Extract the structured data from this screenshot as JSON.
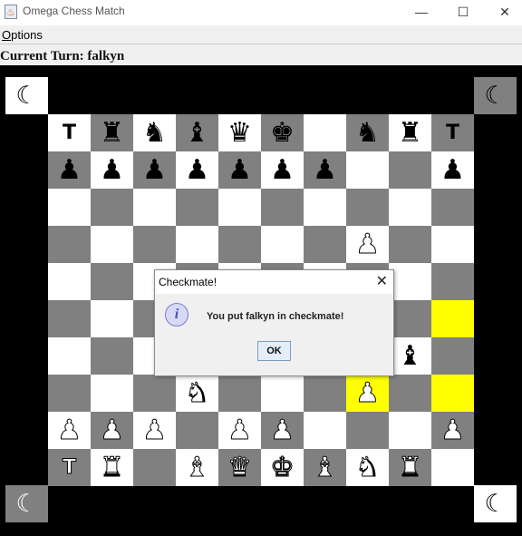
{
  "window": {
    "title": "Omega Chess Match",
    "icon": "app-icon",
    "controls": {
      "minimize": "—",
      "maximize": "☐",
      "close": "✕"
    }
  },
  "menu": {
    "items": [
      {
        "mnemonic": "O",
        "rest": "ptions"
      }
    ]
  },
  "status": {
    "turn_label": "Current Turn: falkyn"
  },
  "board": {
    "colors": {
      "light": "#ffffff",
      "dark": "#808080",
      "highlight": "#ffff00",
      "border": "#000000"
    },
    "corners": [
      {
        "name": "corner-top-left",
        "glyph": "☾",
        "bg": "#ffffff",
        "color": "#000000"
      },
      {
        "name": "corner-top-right",
        "glyph": "☾",
        "bg": "#808080",
        "color": "#000000"
      },
      {
        "name": "corner-bottom-left",
        "glyph": "☾",
        "bg": "#808080",
        "color": "#ffffff"
      },
      {
        "name": "corner-bottom-right",
        "glyph": "☾",
        "bg": "#ffffff",
        "color": "#000000"
      }
    ],
    "highlighted": [
      [
        5,
        9
      ],
      [
        7,
        7
      ],
      [
        7,
        9
      ]
    ],
    "rows": [
      [
        "bT",
        "bR",
        "bN",
        "bB",
        "bQ",
        "bK",
        "",
        "bN",
        "bR",
        "bT"
      ],
      [
        "bP",
        "bP",
        "bP",
        "bP",
        "bP",
        "bP",
        "bP",
        "",
        "",
        "bP"
      ],
      [
        "",
        "",
        "",
        "",
        "",
        "",
        "",
        "",
        "",
        ""
      ],
      [
        "",
        "",
        "",
        "",
        "",
        "",
        "",
        "wP",
        "",
        ""
      ],
      [
        "",
        "",
        "",
        "",
        "",
        "",
        "",
        "",
        "",
        ""
      ],
      [
        "",
        "",
        "",
        "",
        "",
        "",
        "",
        "",
        "",
        ""
      ],
      [
        "",
        "",
        "",
        "",
        "",
        "",
        "",
        "",
        "bB",
        ""
      ],
      [
        "",
        "",
        "",
        "wN",
        "",
        "",
        "",
        "wP",
        "",
        ""
      ],
      [
        "wP",
        "wP",
        "wP",
        "",
        "wP",
        "wP",
        "",
        "",
        "",
        "wP"
      ],
      [
        "wT",
        "wR",
        "",
        "wB",
        "wQ",
        "wK",
        "wB",
        "wN",
        "wR",
        ""
      ]
    ]
  },
  "dialog": {
    "title": "Checkmate!",
    "message": "You put falkyn in checkmate!",
    "ok_label": "OK",
    "icon": "info-icon",
    "icon_glyph": "i"
  }
}
